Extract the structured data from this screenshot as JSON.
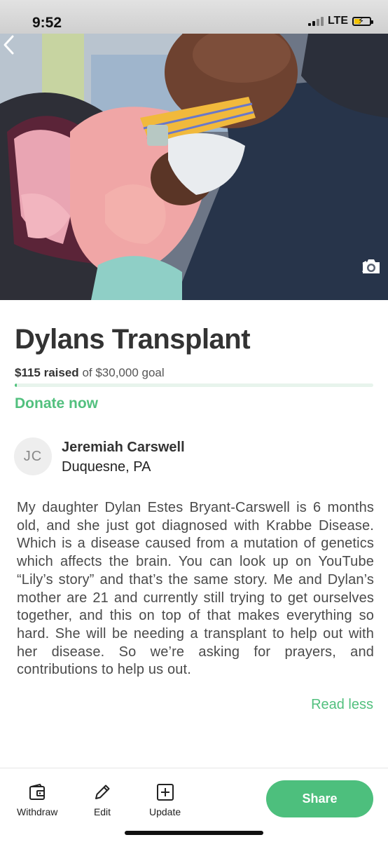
{
  "status_bar": {
    "time": "9:52",
    "network": "LTE"
  },
  "hero": {
    "photo_count": "1"
  },
  "campaign": {
    "title": "Dylans Transplant",
    "raised_amount": "$115 raised",
    "goal_text": "of $30,000 goal",
    "progress_fraction": 0.0038,
    "donate_label": "Donate now"
  },
  "organizer": {
    "initials": "JC",
    "name": "Jeremiah Carswell",
    "location": "Duquesne, PA"
  },
  "story": {
    "text": "My daughter Dylan Estes Bryant-Carswell is 6 months old, and she just got diagnosed with Krabbe Disease. Which is a disease caused from a mutation of genetics which affects the brain. You can look up on YouTube “Lily’s story” and that’s the same story. Me and Dylan’s mother are 21 and currently still trying to get ourselves together, and this on top of that makes everything so hard. She will be needing a transplant to help out with her disease. So we’re asking for prayers, and contributions to help us out.",
    "read_less_label": "Read less"
  },
  "toolbar": {
    "withdraw_label": "Withdraw",
    "edit_label": "Edit",
    "update_label": "Update",
    "share_label": "Share"
  },
  "colors": {
    "accent_green": "#4dbf7d",
    "text_dark": "#333333"
  },
  "icons": [
    "back-chevron-icon",
    "camera-icon",
    "wallet-icon",
    "pencil-icon",
    "plus-square-icon"
  ]
}
